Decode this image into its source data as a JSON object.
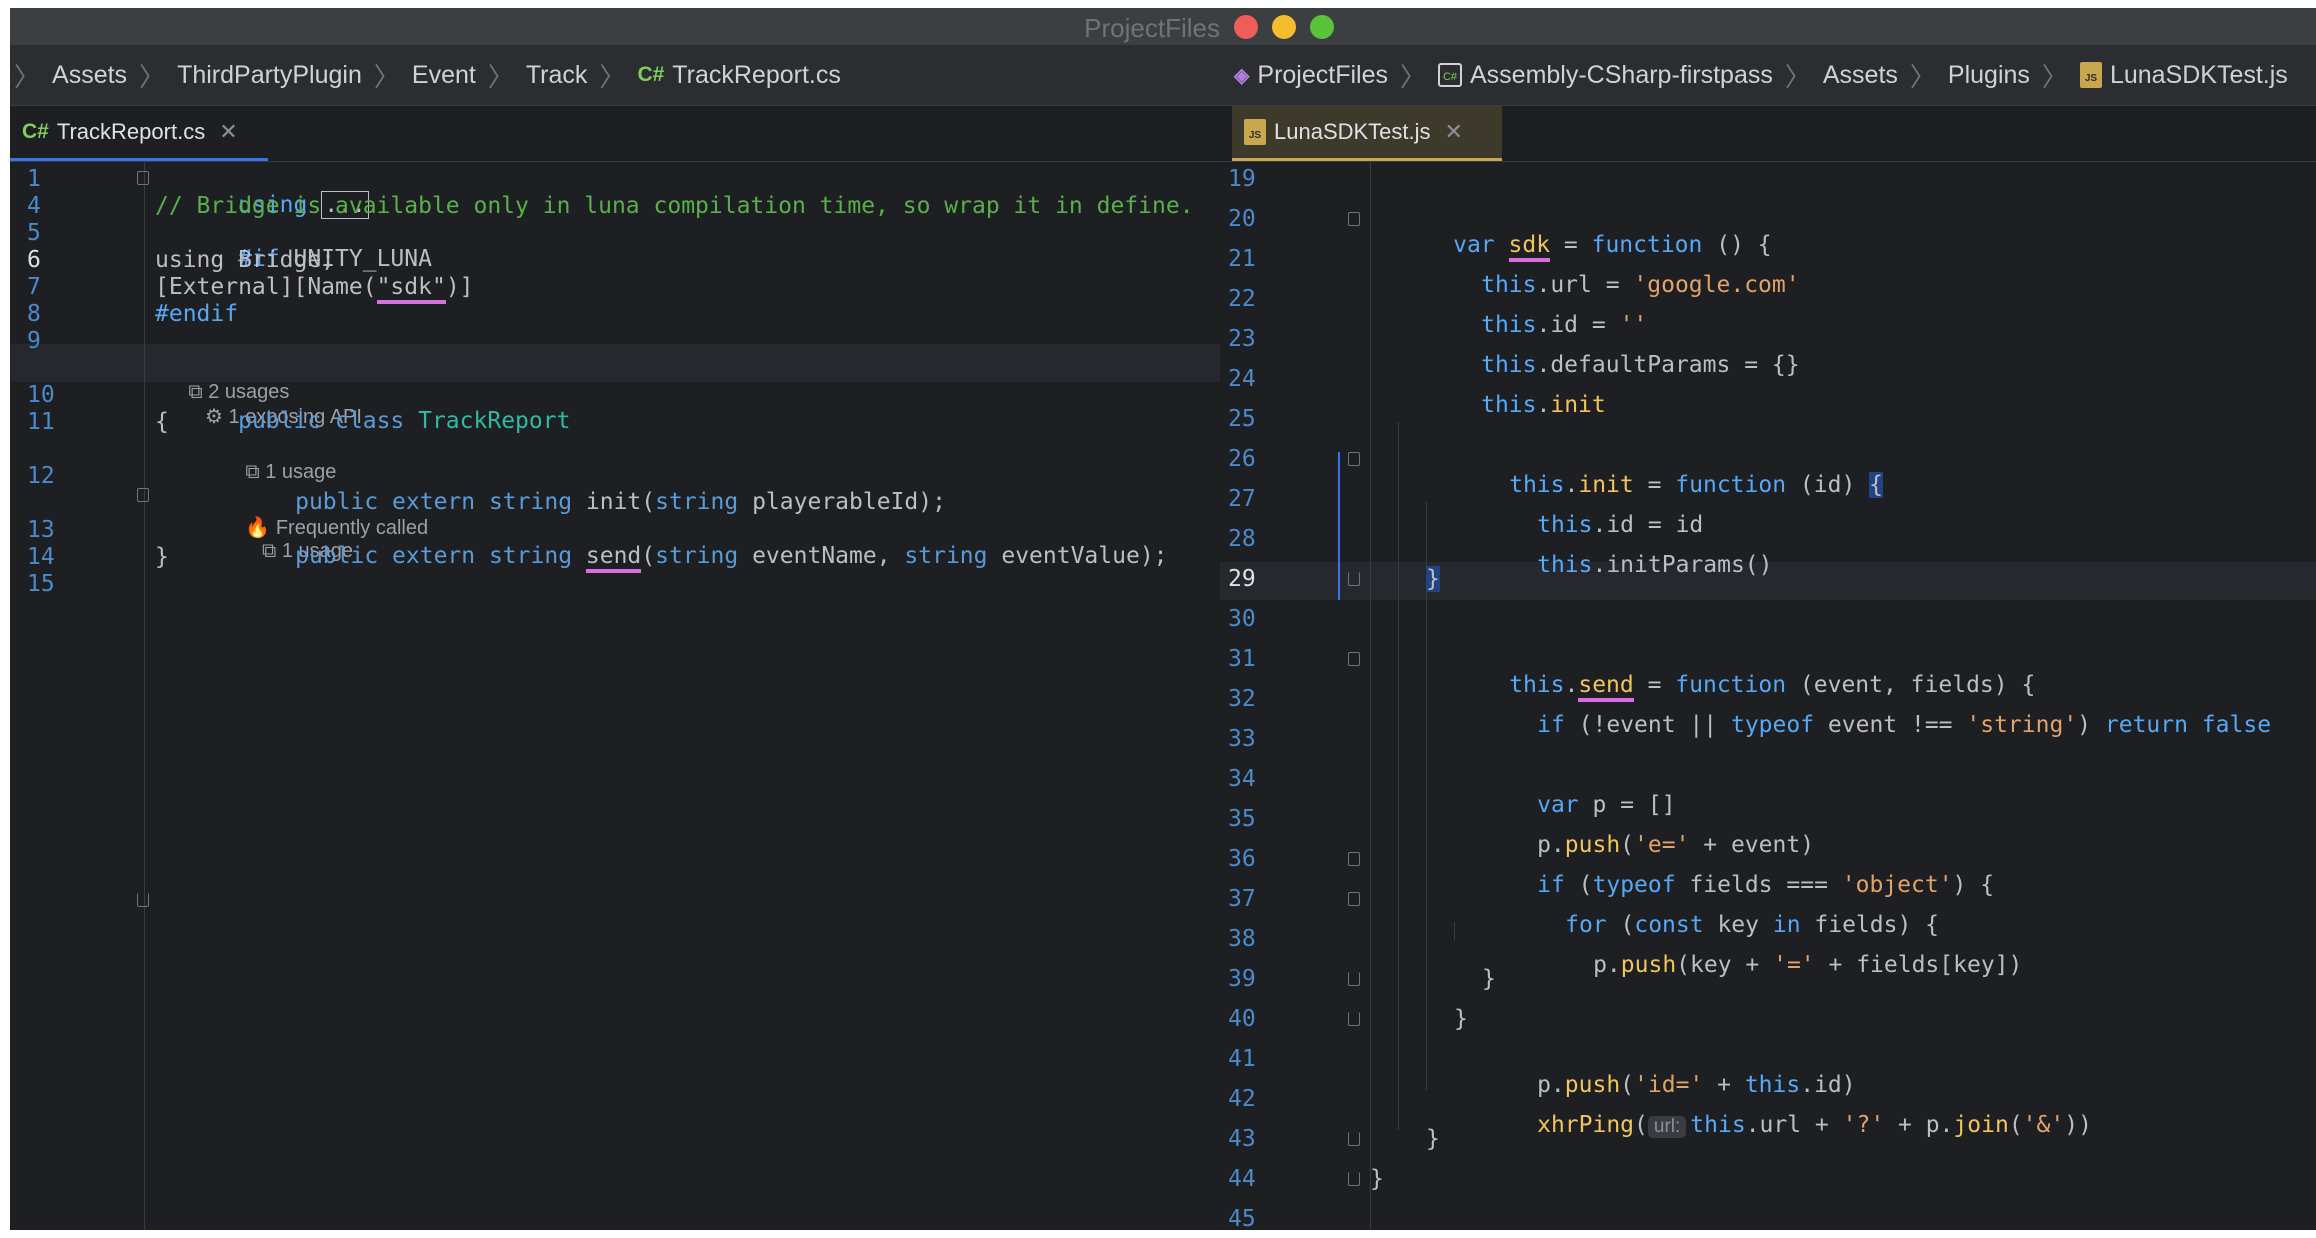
{
  "left_window": {
    "title": "ProjectFiles",
    "breadcrumbs": [
      "Assets",
      "ThirdPartyPlugin",
      "Event",
      "Track",
      "TrackReport.cs"
    ],
    "file_icon": "C#",
    "tab": {
      "label": "TrackReport.cs",
      "icon": "C#"
    },
    "lines": [
      {
        "n": "1",
        "text": "using ..."
      },
      {
        "n": "4",
        "text": "// Bridge is available only in luna compilation time, so wrap it in define."
      },
      {
        "n": "5",
        "text": "#if UNITY_LUNA"
      },
      {
        "n": "6",
        "text": "using Bridge;"
      },
      {
        "n": "7",
        "text": "[External][Name(\"sdk\")]"
      },
      {
        "n": "8",
        "text": "#endif"
      },
      {
        "n": "9",
        "text": ""
      },
      {
        "n": "10",
        "text": "public class TrackReport"
      },
      {
        "n": "11",
        "text": "{"
      },
      {
        "n": "12",
        "text": "public extern string init(string playerableId);"
      },
      {
        "n": "13",
        "text": "public extern string send(string eventName, string eventValue);"
      },
      {
        "n": "14",
        "text": "}"
      },
      {
        "n": "15",
        "text": ""
      }
    ],
    "lenses": {
      "class_usages": "2 usages",
      "class_api": "1 exposing API",
      "init_usages": "1 usage",
      "send_frequent": "Frequently called",
      "send_usages": "1 usage"
    }
  },
  "right_window": {
    "breadcrumbs": [
      "ProjectFiles",
      "Assembly-CSharp-firstpass",
      "Assets",
      "Plugins",
      "LunaSDKTest.js"
    ],
    "tab": {
      "label": "LunaSDKTest.js",
      "icon": "JS"
    },
    "lines": [
      {
        "n": "19",
        "text": ""
      },
      {
        "n": "20",
        "text": "var sdk = function () {"
      },
      {
        "n": "21",
        "text": "this.url = 'google.com'"
      },
      {
        "n": "22",
        "text": "this.id = ''"
      },
      {
        "n": "23",
        "text": "this.defaultParams = {}"
      },
      {
        "n": "24",
        "text": "this.init"
      },
      {
        "n": "25",
        "text": ""
      },
      {
        "n": "26",
        "text": "this.init = function (id) {"
      },
      {
        "n": "27",
        "text": "this.id = id"
      },
      {
        "n": "28",
        "text": "this.initParams()"
      },
      {
        "n": "29",
        "text": "}"
      },
      {
        "n": "30",
        "text": ""
      },
      {
        "n": "31",
        "text": "this.send = function (event, fields) {"
      },
      {
        "n": "32",
        "text": "if (!event || typeof event !== 'string') return false"
      },
      {
        "n": "33",
        "text": ""
      },
      {
        "n": "34",
        "text": "var p = []"
      },
      {
        "n": "35",
        "text": "p.push('e=' + event)"
      },
      {
        "n": "36",
        "text": "if (typeof fields === 'object') {"
      },
      {
        "n": "37",
        "text": "for (const key in fields) {"
      },
      {
        "n": "38",
        "text": "p.push(key + '=' + fields[key])"
      },
      {
        "n": "39",
        "text": "}"
      },
      {
        "n": "40",
        "text": "}"
      },
      {
        "n": "41",
        "text": "p.push('id=' + this.id)"
      },
      {
        "n": "42",
        "text": "xhrPing(url: this.url + '?' + p.join('&'))"
      },
      {
        "n": "43",
        "text": "}"
      },
      {
        "n": "44",
        "text": "}"
      },
      {
        "n": "45",
        "text": ""
      }
    ],
    "param_hint": "url:"
  }
}
